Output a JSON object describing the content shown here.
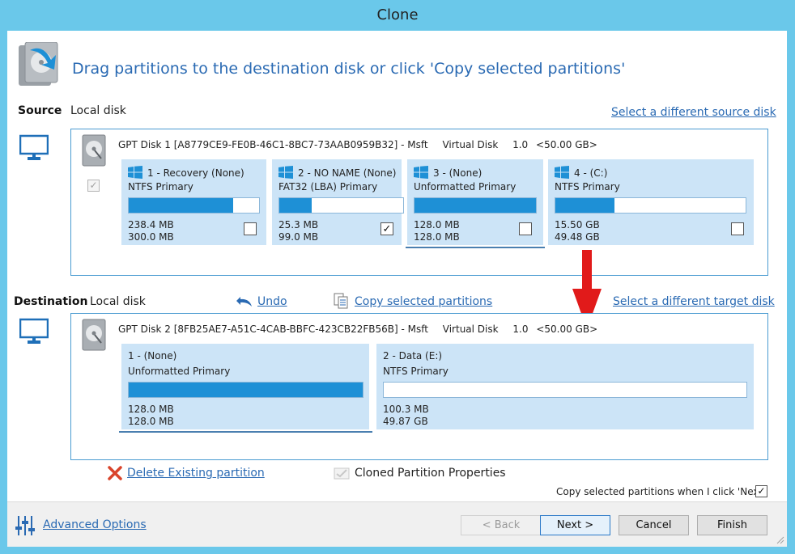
{
  "window": {
    "title": "Clone"
  },
  "header": {
    "instruction": "Drag partitions to the destination disk or click 'Copy selected partitions'"
  },
  "source": {
    "label": "Source",
    "disk_type": "Local disk",
    "change_link": "Select a different source disk",
    "disk": {
      "name": "GPT Disk 1 [A8779CE9-FE0B-46C1-8BC7-73AAB0959B32] - Msft",
      "kind": "Virtual Disk",
      "version": "1.0",
      "size": "<50.00 GB>"
    },
    "partitions": [
      {
        "name": "1 - Recovery (None)",
        "type": "NTFS Primary",
        "used": "238.4 MB",
        "total": "300.0 MB",
        "fill_fraction": 0.8,
        "checked": false
      },
      {
        "name": "2 - NO NAME (None)",
        "type": "FAT32 (LBA) Primary",
        "used": "25.3 MB",
        "total": "99.0 MB",
        "fill_fraction": 0.26,
        "checked": true
      },
      {
        "name": "3 -  (None)",
        "type": "Unformatted Primary",
        "used": "128.0 MB",
        "total": "128.0 MB",
        "fill_fraction": 1.0,
        "checked": false
      },
      {
        "name": "4 -  (C:)",
        "type": "NTFS Primary",
        "used": "15.50 GB",
        "total": "49.48 GB",
        "fill_fraction": 0.31,
        "checked": false
      }
    ]
  },
  "destination": {
    "label": "Destination",
    "disk_type": "Local disk",
    "undo_link": "Undo",
    "copy_link": "Copy selected partitions",
    "change_link": "Select a different target disk",
    "disk": {
      "name": "GPT Disk 2 [8FB25AE7-A51C-4CAB-BBFC-423CB22FB56B] - Msft",
      "kind": "Virtual Disk",
      "version": "1.0",
      "size": "<50.00 GB>"
    },
    "partitions": [
      {
        "name": "1 -  (None)",
        "type": "Unformatted Primary",
        "used": "128.0 MB",
        "total": "128.0 MB",
        "fill_fraction": 1.0
      },
      {
        "name": "2 - Data (E:)",
        "type": "NTFS Primary",
        "used": "100.3 MB",
        "total": "49.87 GB",
        "fill_fraction": 0.0
      }
    ]
  },
  "actions": {
    "delete_link": "Delete Existing partition",
    "cloned_props": "Cloned Partition Properties",
    "copy_on_next": "Copy selected partitions when I click 'Next'",
    "copy_on_next_checked": true
  },
  "footer": {
    "advanced_link": "Advanced Options",
    "back": "< Back",
    "next": "Next >",
    "cancel": "Cancel",
    "finish": "Finish"
  },
  "colors": {
    "accent": "#2a6ab3",
    "bar_fill": "#1e90d6",
    "part_bg": "#cce4f7",
    "arrow": "#e11a1a",
    "frame": "#6ac8ea"
  }
}
